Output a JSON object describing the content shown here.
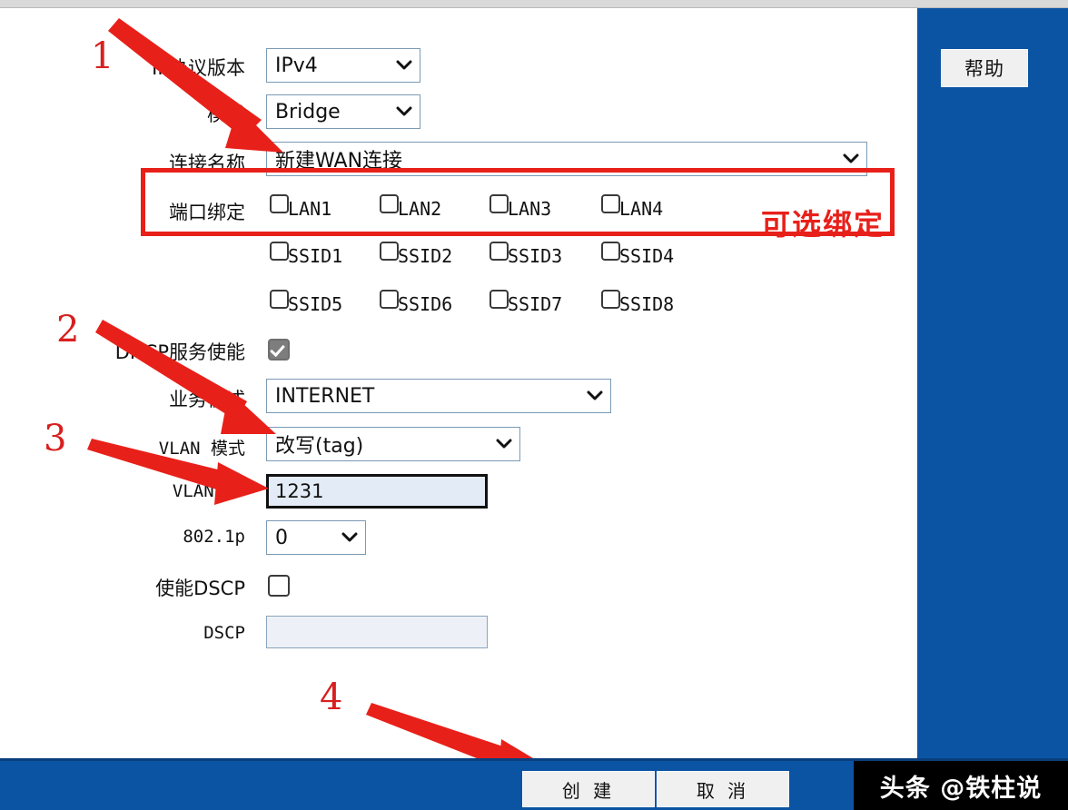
{
  "window": {
    "help_button": "帮助",
    "watermark": "头条 @铁柱说",
    "accent_blue": "#0b54a4",
    "annotation_red": "#e8201a"
  },
  "form": {
    "fields": [
      {
        "label": "IP协议版本",
        "value": "IPv4",
        "type": "select"
      },
      {
        "label": "模式",
        "value": "Bridge",
        "type": "select"
      },
      {
        "label": "连接名称",
        "value": "新建WAN连接",
        "type": "select"
      },
      {
        "label": "端口绑定",
        "value": "",
        "type": "checkbox-group"
      },
      {
        "label": "DHCP服务使能",
        "value": "",
        "type": "checkbox"
      },
      {
        "label": "业务模式",
        "value": "INTERNET",
        "type": "select"
      },
      {
        "label": "VLAN 模式",
        "value": "改写(tag)",
        "type": "select"
      },
      {
        "label": "VLAN ID",
        "value": "1231",
        "type": "text"
      },
      {
        "label": "802.1p",
        "value": "0",
        "type": "select"
      },
      {
        "label": "使能DSCP",
        "value": "",
        "type": "checkbox"
      },
      {
        "label": "DSCP",
        "value": "",
        "type": "text"
      }
    ],
    "port_binding": {
      "row1": [
        "LAN1",
        "LAN2",
        "LAN3",
        "LAN4"
      ],
      "row2": [
        "SSID1",
        "SSID2",
        "SSID3",
        "SSID4"
      ],
      "row3": [
        "SSID5",
        "SSID6",
        "SSID7",
        "SSID8"
      ],
      "checked": []
    },
    "dhcp_enable_checked": true,
    "dscp_enable_checked": false
  },
  "footer": {
    "create_label": "创 建",
    "cancel_label": "取 消"
  },
  "annotations": {
    "n1": "1",
    "n2": "2",
    "n3": "3",
    "n4": "4",
    "optional_binding": "可选绑定"
  }
}
